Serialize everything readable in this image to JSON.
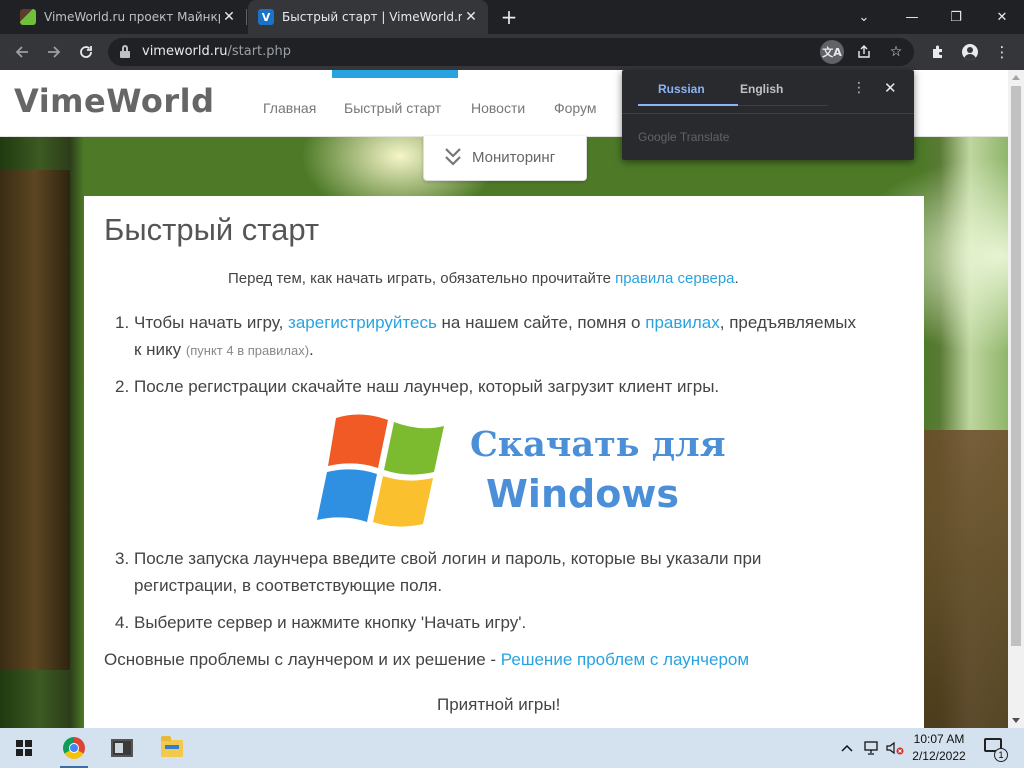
{
  "browser": {
    "tabs": [
      {
        "title": "VimeWorld.ru проект Майнкрафт",
        "active": false,
        "close": "✕"
      },
      {
        "title": "Быстрый старт | VimeWorld.ru -",
        "active": true,
        "close": "✕",
        "favicon_text": "V"
      }
    ],
    "new_tab": "+",
    "window_controls": {
      "minimize": "⌄",
      "restore": "—",
      "maximize": "❐",
      "close": "✕"
    },
    "url_host": "vimeworld.ru",
    "url_path": "/start.php",
    "icons": [
      "back-icon",
      "forward-icon",
      "reload-icon",
      "lock-icon",
      "translate-icon",
      "share-icon",
      "star-icon",
      "extensions-icon",
      "profile-icon",
      "menu-icon"
    ]
  },
  "site": {
    "logo": "VimeWorld",
    "nav": [
      "Главная",
      "Быстрый старт",
      "Новости",
      "Форум"
    ],
    "monitoring": "Мониторинг",
    "accent": "#29a3df"
  },
  "content": {
    "title": "Быстрый старт",
    "intro": "Перед тем, как начать играть, обязательно прочитайте ",
    "intro_link": "правила сервера",
    "intro_end": ".",
    "steps": [
      {
        "num": "1.",
        "p1": "Чтобы начать игру, ",
        "link1": "зарегистрируйтесь",
        "p2": " на нашем сайте, помня о ",
        "link2": "правилах",
        "p3": ", предъявляемых",
        "line2": "к нику ",
        "note": "(пункт 4 в правилах)",
        "end": "."
      },
      {
        "num": "2.",
        "text": "После регистрации скачайте наш лаунчер, который загрузит клиент игры."
      },
      {
        "num": "3.",
        "line1": "После запуска лаунчера введите свой логин и пароль, которые вы указали при",
        "line2": "регистрации, в соответствующие поля."
      },
      {
        "num": "4.",
        "text": "Выберите сервер и нажмите кнопку 'Начать игру'."
      }
    ],
    "download": {
      "line1": "Скачать для",
      "line2": "Windows"
    },
    "problems": "Основные проблемы с лаунчером и их решение - ",
    "problems_link": "Решение проблем с лаунчером",
    "farewell": "Приятной игры!"
  },
  "translate_popup": {
    "lang_from": "Russian",
    "lang_to": "English",
    "more": "⋮",
    "close": "✕",
    "footer": "Google Translate"
  },
  "taskbar": {
    "time": "10:07 AM",
    "date": "2/12/2022",
    "notification_count": "1",
    "apps": [
      "chrome-icon",
      "app-window-icon",
      "file-explorer-icon"
    ]
  }
}
